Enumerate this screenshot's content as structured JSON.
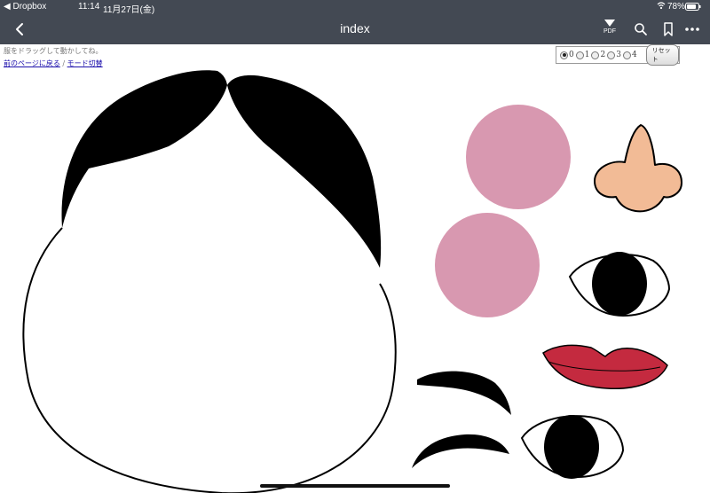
{
  "status_bar": {
    "back_app": "◀ Dropbox",
    "time": "11:14",
    "date": "11月27日(金)",
    "battery": "78%"
  },
  "nav": {
    "title": "index",
    "pdf_label": "PDF"
  },
  "page": {
    "hint": "服をドラッグして動かしてね。",
    "prev_link": "前のページに戻る",
    "separator": " / ",
    "mode_link": "モード切替"
  },
  "controls": {
    "options": [
      "0",
      "1",
      "2",
      "3",
      "4"
    ],
    "selected": "0",
    "reset_label": "リセット"
  },
  "colors": {
    "bar": "#434953",
    "cheek": "#d898b0",
    "nose": "#f2bb96",
    "lips": "#c42a3f",
    "hair": "#000000"
  }
}
